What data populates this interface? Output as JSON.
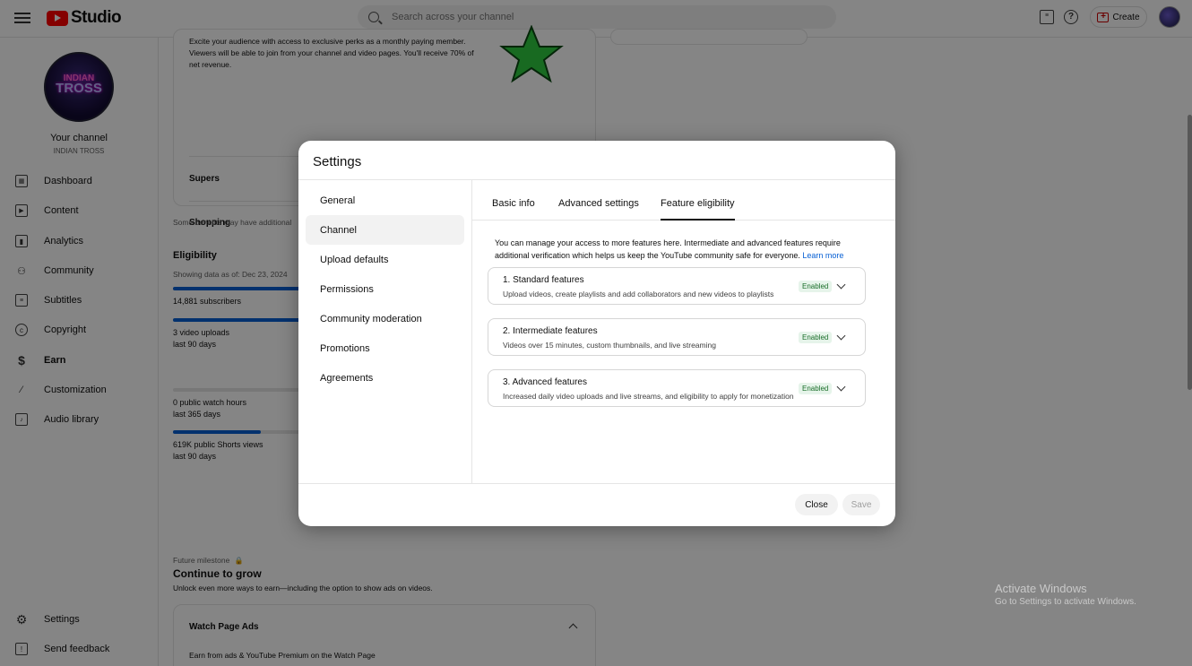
{
  "header": {
    "logo_text": "Studio",
    "search_placeholder": "Search across your channel",
    "create_label": "Create"
  },
  "sidebar": {
    "channel_label": "Your channel",
    "channel_name": "INDIAN TROSS",
    "avatar_text_top": "INDIAN",
    "avatar_text_main": "TROSS",
    "items": [
      {
        "label": "Dashboard",
        "icon": "dashboard-icon"
      },
      {
        "label": "Content",
        "icon": "content-icon"
      },
      {
        "label": "Analytics",
        "icon": "analytics-icon"
      },
      {
        "label": "Community",
        "icon": "community-icon"
      },
      {
        "label": "Subtitles",
        "icon": "subtitles-icon"
      },
      {
        "label": "Copyright",
        "icon": "copyright-icon"
      },
      {
        "label": "Earn",
        "icon": "dollar-icon"
      },
      {
        "label": "Customization",
        "icon": "magic-wand-icon"
      },
      {
        "label": "Audio library",
        "icon": "audio-library-icon"
      }
    ],
    "bottom_items": [
      {
        "label": "Settings",
        "icon": "gear-icon"
      },
      {
        "label": "Send feedback",
        "icon": "feedback-icon"
      }
    ]
  },
  "background": {
    "membership_desc": "Excite your audience with access to exclusive perks as a monthly paying member. Viewers will be able to join from your channel and video pages. You'll receive 70% of net revenue.",
    "supers": "Supers",
    "shopping": "Shopping",
    "benefits_note": "Some benefits may have additional",
    "eligibility_title": "Eligibility",
    "eligibility_date": "Showing data as of: Dec 23, 2024",
    "subscribers": "14,881 subscribers",
    "uploads": "3 video uploads",
    "uploads_period": "last 90 days",
    "watch_hours": "0 public watch hours",
    "watch_period": "last 365 days",
    "shorts_views": "619K public Shorts views",
    "shorts_period": "last 90 days",
    "future_label": "Future milestone",
    "grow_title": "Continue to grow",
    "grow_desc": "Unlock even more ways to earn—including the option to show ads on videos.",
    "watch_page_ads": "Watch Page Ads",
    "watch_page_desc": "Earn from ads & YouTube Premium on the Watch Page",
    "progress": {
      "subscribers": 0.95,
      "uploads": 0.95,
      "watch_hours": 0.0,
      "shorts_views": 0.35
    }
  },
  "watermark": {
    "line1": "Activate Windows",
    "line2": "Go to Settings to activate Windows."
  },
  "dialog": {
    "title": "Settings",
    "nav": [
      {
        "label": "General",
        "active": false
      },
      {
        "label": "Channel",
        "active": true
      },
      {
        "label": "Upload defaults",
        "active": false
      },
      {
        "label": "Permissions",
        "active": false
      },
      {
        "label": "Community moderation",
        "active": false
      },
      {
        "label": "Promotions",
        "active": false
      },
      {
        "label": "Agreements",
        "active": false
      }
    ],
    "tabs": [
      {
        "label": "Basic info",
        "active": false
      },
      {
        "label": "Advanced settings",
        "active": false
      },
      {
        "label": "Feature eligibility",
        "active": true
      }
    ],
    "intro": "You can manage your access to more features here. Intermediate and advanced features require additional verification which helps us keep the YouTube community safe for everyone.",
    "learn_more": "Learn more",
    "features": [
      {
        "title": "1. Standard features",
        "desc": "Upload videos, create playlists and add collaborators and new videos to playlists",
        "status": "Enabled"
      },
      {
        "title": "2. Intermediate features",
        "desc": "Videos over 15 minutes, custom thumbnails, and live streaming",
        "status": "Enabled"
      },
      {
        "title": "3. Advanced features",
        "desc": "Increased daily video uploads and live streams, and eligibility to apply for monetization",
        "status": "Enabled"
      }
    ],
    "close_label": "Close",
    "save_label": "Save"
  }
}
